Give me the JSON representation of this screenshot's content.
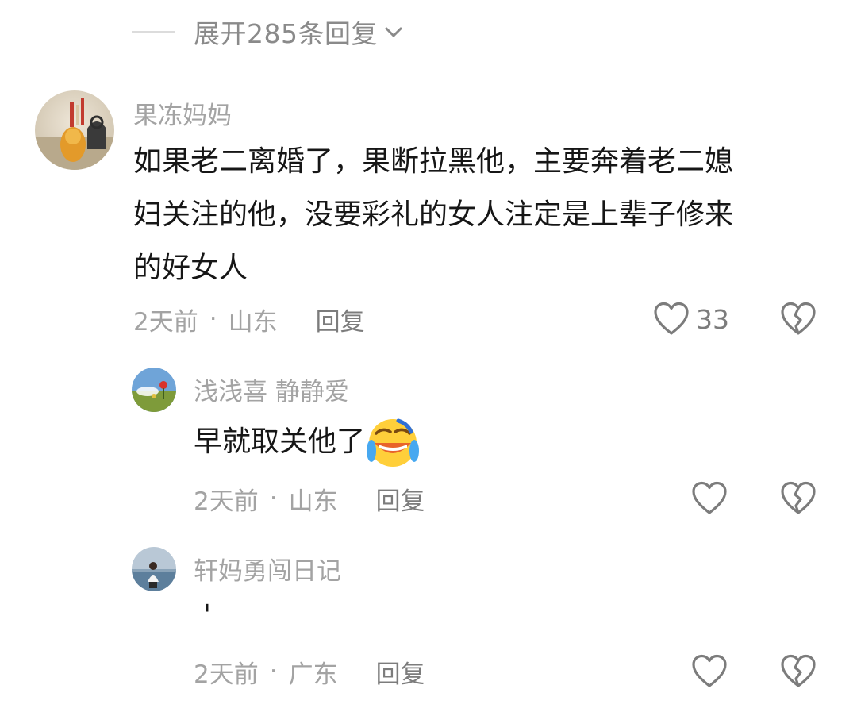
{
  "expand": {
    "label": "展开285条回复"
  },
  "comment": {
    "username": "果冻妈妈",
    "line1": "如果老二离婚了，果断拉黑他，主要奔着老二媳",
    "line2": "妇关注的他，没要彩礼的女人注定是上辈子修来",
    "line3": "的好女人",
    "time": "2天前",
    "sep": "·",
    "location": "山东",
    "reply_label": "回复",
    "likes": "33"
  },
  "replies": [
    {
      "username": "浅浅喜 静静爱",
      "text": "早就取关他了",
      "emoji": "crying-laughing-emoji",
      "time": "2天前",
      "sep": "·",
      "location": "山东",
      "reply_label": "回复"
    },
    {
      "username": "轩妈勇闯日记",
      "text": "'",
      "time": "2天前",
      "sep": "·",
      "location": "广东",
      "reply_label": "回复"
    }
  ],
  "icons": {
    "expand": "chevron-down-icon",
    "like": "heart-icon",
    "dislike": "broken-heart-icon"
  },
  "colors": {
    "meta_text": "#a3a3a3",
    "content_text": "#161616",
    "icon_stroke": "#7c7c7c"
  }
}
